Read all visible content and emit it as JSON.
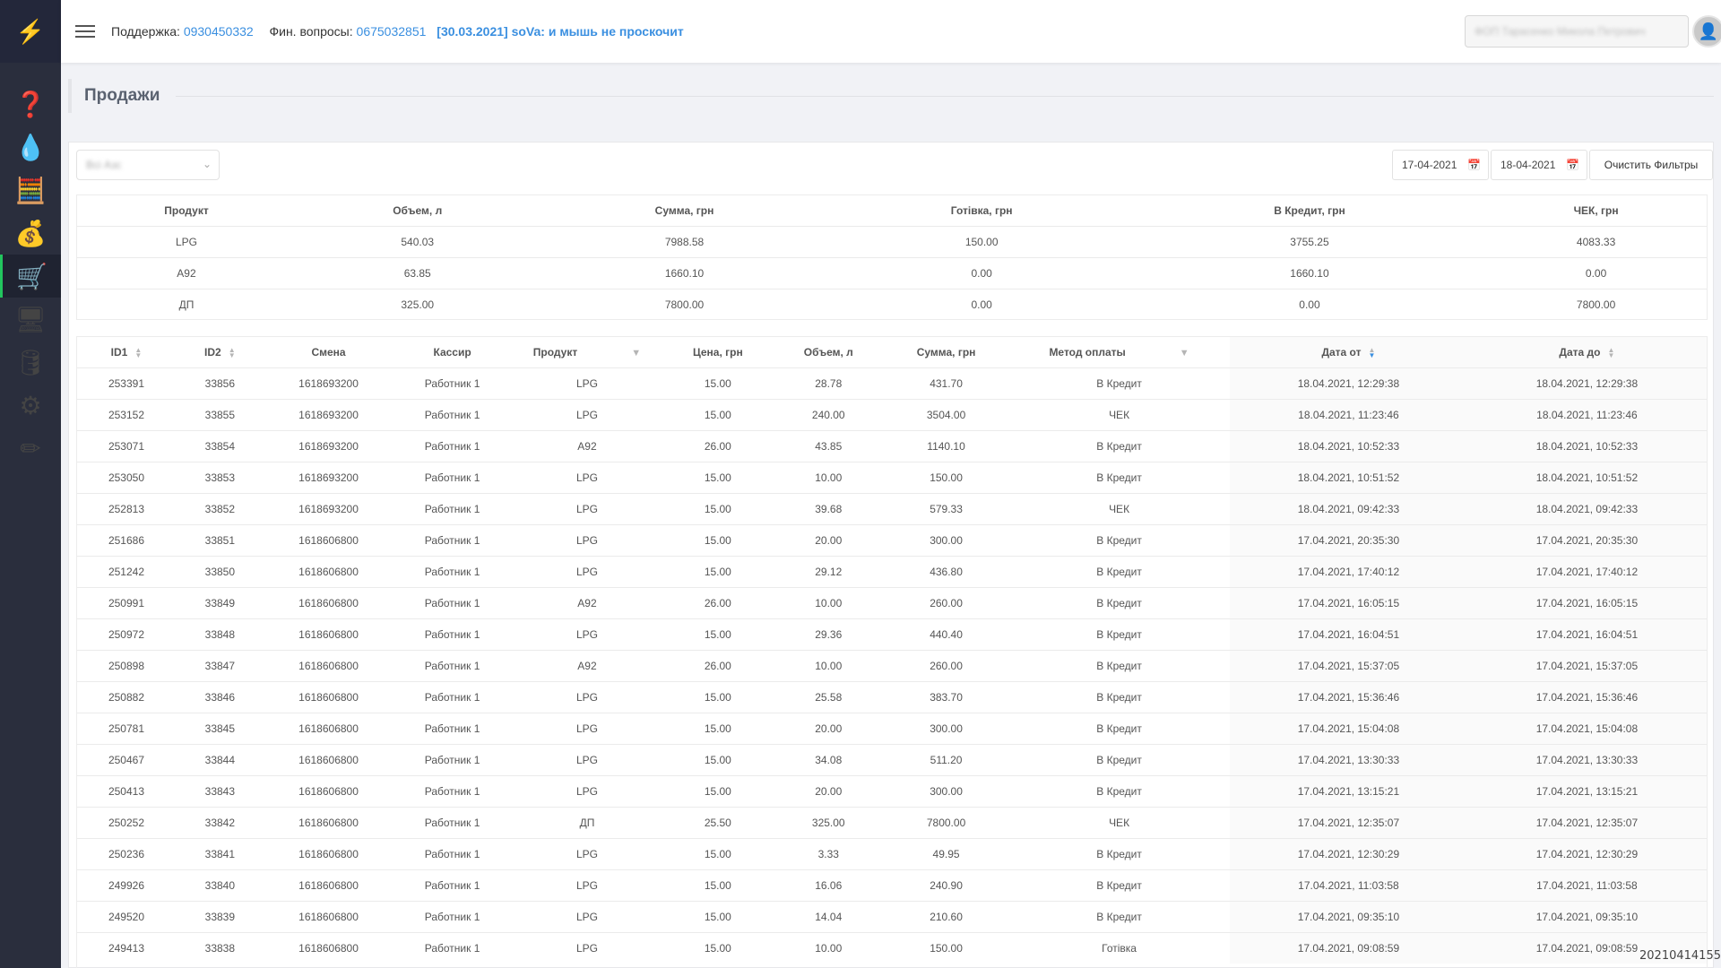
{
  "sidebar": {
    "logo_icon": "⚡",
    "items": [
      {
        "icon": "question-icon",
        "glyph": "❓",
        "active": false
      },
      {
        "icon": "fuel-drop-icon",
        "glyph": "💧",
        "active": false
      },
      {
        "icon": "calculator-icon",
        "glyph": "🧮",
        "active": false
      },
      {
        "icon": "money-bag-icon",
        "glyph": "💰",
        "active": false
      },
      {
        "icon": "cart-icon",
        "glyph": "🛒",
        "active": true
      },
      {
        "icon": "register-icon",
        "glyph": "🖥",
        "active": false
      },
      {
        "icon": "fuel-tank-icon",
        "glyph": "🛢",
        "active": false
      },
      {
        "icon": "settings-user-icon",
        "glyph": "⚙",
        "active": false
      },
      {
        "icon": "pencil-icon",
        "glyph": "✏",
        "active": false
      }
    ]
  },
  "header": {
    "support_label": "Поддержка:",
    "support_phone": "0930450332",
    "finance_label": "Фин. вопросы:",
    "finance_phone": "0675032851",
    "news": "[30.03.2021] soVa: и мышь не проскочит",
    "company_select": "ФОП Тарасенко Микола Петрович",
    "avatar_icon": "👤"
  },
  "page": {
    "title": "Продажи"
  },
  "filters": {
    "station_select": "Всі Азс",
    "date_from": "17-04-2021",
    "date_to": "18-04-2021",
    "clear_label": "Очистить Фильтры",
    "calendar_icon": "📅",
    "chevron_icon": "⌄"
  },
  "summary": {
    "headers": [
      "Продукт",
      "Объем, л",
      "Сумма, грн",
      "Готівка, грн",
      "В Кредит, грн",
      "ЧЕК, грн"
    ],
    "rows": [
      [
        "LPG",
        "540.03",
        "7988.58",
        "150.00",
        "3755.25",
        "4083.33"
      ],
      [
        "A92",
        "63.85",
        "1660.10",
        "0.00",
        "1660.10",
        "0.00"
      ],
      [
        "ДП",
        "325.00",
        "7800.00",
        "0.00",
        "0.00",
        "7800.00"
      ]
    ]
  },
  "sales": {
    "headers": [
      "ID1",
      "ID2",
      "Смена",
      "Кассир",
      "Продукт",
      "Цена, грн",
      "Объем, л",
      "Сумма, грн",
      "Метод оплаты",
      "Дата от",
      "Дата до"
    ],
    "rows": [
      [
        "253391",
        "33856",
        "1618693200",
        "Работник 1",
        "LPG",
        "15.00",
        "28.78",
        "431.70",
        "В Кредит",
        "18.04.2021, 12:29:38",
        "18.04.2021, 12:29:38"
      ],
      [
        "253152",
        "33855",
        "1618693200",
        "Работник 1",
        "LPG",
        "15.00",
        "240.00",
        "3504.00",
        "ЧЕК",
        "18.04.2021, 11:23:46",
        "18.04.2021, 11:23:46"
      ],
      [
        "253071",
        "33854",
        "1618693200",
        "Работник 1",
        "A92",
        "26.00",
        "43.85",
        "1140.10",
        "В Кредит",
        "18.04.2021, 10:52:33",
        "18.04.2021, 10:52:33"
      ],
      [
        "253050",
        "33853",
        "1618693200",
        "Работник 1",
        "LPG",
        "15.00",
        "10.00",
        "150.00",
        "В Кредит",
        "18.04.2021, 10:51:52",
        "18.04.2021, 10:51:52"
      ],
      [
        "252813",
        "33852",
        "1618693200",
        "Работник 1",
        "LPG",
        "15.00",
        "39.68",
        "579.33",
        "ЧЕК",
        "18.04.2021, 09:42:33",
        "18.04.2021, 09:42:33"
      ],
      [
        "251686",
        "33851",
        "1618606800",
        "Работник 1",
        "LPG",
        "15.00",
        "20.00",
        "300.00",
        "В Кредит",
        "17.04.2021, 20:35:30",
        "17.04.2021, 20:35:30"
      ],
      [
        "251242",
        "33850",
        "1618606800",
        "Работник 1",
        "LPG",
        "15.00",
        "29.12",
        "436.80",
        "В Кредит",
        "17.04.2021, 17:40:12",
        "17.04.2021, 17:40:12"
      ],
      [
        "250991",
        "33849",
        "1618606800",
        "Работник 1",
        "A92",
        "26.00",
        "10.00",
        "260.00",
        "В Кредит",
        "17.04.2021, 16:05:15",
        "17.04.2021, 16:05:15"
      ],
      [
        "250972",
        "33848",
        "1618606800",
        "Работник 1",
        "LPG",
        "15.00",
        "29.36",
        "440.40",
        "В Кредит",
        "17.04.2021, 16:04:51",
        "17.04.2021, 16:04:51"
      ],
      [
        "250898",
        "33847",
        "1618606800",
        "Работник 1",
        "A92",
        "26.00",
        "10.00",
        "260.00",
        "В Кредит",
        "17.04.2021, 15:37:05",
        "17.04.2021, 15:37:05"
      ],
      [
        "250882",
        "33846",
        "1618606800",
        "Работник 1",
        "LPG",
        "15.00",
        "25.58",
        "383.70",
        "В Кредит",
        "17.04.2021, 15:36:46",
        "17.04.2021, 15:36:46"
      ],
      [
        "250781",
        "33845",
        "1618606800",
        "Работник 1",
        "LPG",
        "15.00",
        "20.00",
        "300.00",
        "В Кредит",
        "17.04.2021, 15:04:08",
        "17.04.2021, 15:04:08"
      ],
      [
        "250467",
        "33844",
        "1618606800",
        "Работник 1",
        "LPG",
        "15.00",
        "34.08",
        "511.20",
        "В Кредит",
        "17.04.2021, 13:30:33",
        "17.04.2021, 13:30:33"
      ],
      [
        "250413",
        "33843",
        "1618606800",
        "Работник 1",
        "LPG",
        "15.00",
        "20.00",
        "300.00",
        "В Кредит",
        "17.04.2021, 13:15:21",
        "17.04.2021, 13:15:21"
      ],
      [
        "250252",
        "33842",
        "1618606800",
        "Работник 1",
        "ДП",
        "25.50",
        "325.00",
        "7800.00",
        "ЧЕК",
        "17.04.2021, 12:35:07",
        "17.04.2021, 12:35:07"
      ],
      [
        "250236",
        "33841",
        "1618606800",
        "Работник 1",
        "LPG",
        "15.00",
        "3.33",
        "49.95",
        "В Кредит",
        "17.04.2021, 12:30:29",
        "17.04.2021, 12:30:29"
      ],
      [
        "249926",
        "33840",
        "1618606800",
        "Работник 1",
        "LPG",
        "15.00",
        "16.06",
        "240.90",
        "В Кредит",
        "17.04.2021, 11:03:58",
        "17.04.2021, 11:03:58"
      ],
      [
        "249520",
        "33839",
        "1618606800",
        "Работник 1",
        "LPG",
        "15.00",
        "14.04",
        "210.60",
        "В Кредит",
        "17.04.2021, 09:35:10",
        "17.04.2021, 09:35:10"
      ],
      [
        "249413",
        "33838",
        "1618606800",
        "Работник 1",
        "LPG",
        "15.00",
        "10.00",
        "150.00",
        "Готівка",
        "17.04.2021, 09:08:59",
        "17.04.2021, 09:08:59"
      ]
    ]
  },
  "footer_stamp": "20210414155",
  "colors": {
    "sidebar_bg": "#2a2e3d",
    "accent_link": "#3a8fe0",
    "active_green": "#22c55e"
  }
}
